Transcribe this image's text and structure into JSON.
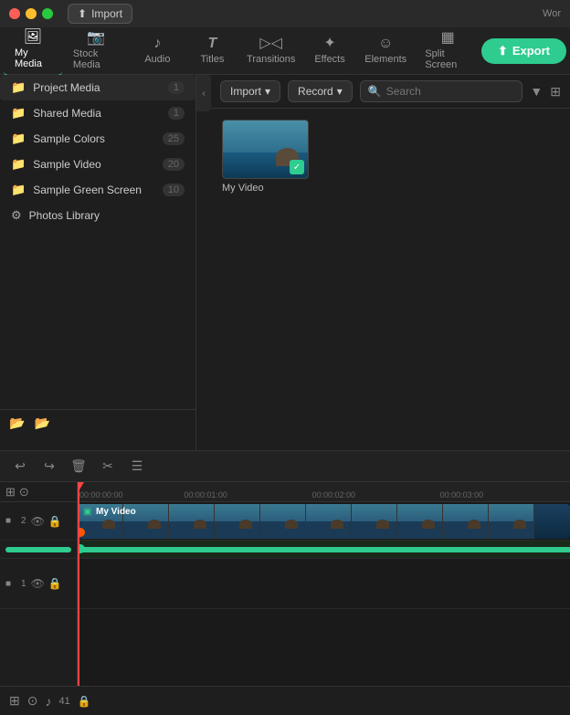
{
  "titlebar": {
    "app_name": "Wor",
    "import_label": "Import",
    "import_icon": "⬆"
  },
  "nav": {
    "tabs": [
      {
        "id": "my-media",
        "label": "My Media",
        "icon": "🖼",
        "active": true
      },
      {
        "id": "stock-media",
        "label": "Stock Media",
        "icon": "📷",
        "active": false
      },
      {
        "id": "audio",
        "label": "Audio",
        "icon": "♪",
        "active": false
      },
      {
        "id": "titles",
        "label": "Titles",
        "icon": "T",
        "active": false
      },
      {
        "id": "transitions",
        "label": "Transitions",
        "icon": "⊳⊲",
        "active": false
      },
      {
        "id": "effects",
        "label": "Effects",
        "icon": "✦",
        "active": false
      },
      {
        "id": "elements",
        "label": "Elements",
        "icon": "☺",
        "active": false
      },
      {
        "id": "split-screen",
        "label": "Split Screen",
        "icon": "▦",
        "active": false
      }
    ],
    "export_label": "Export",
    "export_icon": "⬆"
  },
  "sidebar": {
    "items": [
      {
        "id": "project-media",
        "label": "Project Media",
        "count": "1",
        "active": true
      },
      {
        "id": "shared-media",
        "label": "Shared Media",
        "count": "1",
        "active": false
      },
      {
        "id": "sample-colors",
        "label": "Sample Colors",
        "count": "25",
        "active": false
      },
      {
        "id": "sample-video",
        "label": "Sample Video",
        "count": "20",
        "active": false
      },
      {
        "id": "sample-green-screen",
        "label": "Sample Green Screen",
        "count": "10",
        "active": false
      },
      {
        "id": "photos-library",
        "label": "Photos Library",
        "count": "",
        "active": false
      }
    ]
  },
  "media_panel": {
    "import_label": "Import",
    "record_label": "Record",
    "record_arrow": "▾",
    "import_arrow": "▾",
    "search_placeholder": "Search",
    "items": [
      {
        "id": "my-video",
        "label": "My Video",
        "has_check": true
      }
    ]
  },
  "timeline": {
    "undo_icon": "↩",
    "redo_icon": "↪",
    "delete_icon": "🗑",
    "cut_icon": "✂",
    "list_icon": "☰",
    "time_markers": [
      {
        "time": "00:00:00:00",
        "pos_pct": 0
      },
      {
        "time": "00:00:01:00",
        "pos_pct": 26
      },
      {
        "time": "00:00:02:00",
        "pos_pct": 52
      },
      {
        "time": "00:00:03:00",
        "pos_pct": 78
      }
    ],
    "tracks": [
      {
        "id": "track-2",
        "label": "2",
        "icons": [
          "▣",
          "👁",
          "🔒"
        ],
        "has_clip": true,
        "clip_label": "My Video",
        "clip_icon": "▣"
      },
      {
        "id": "track-green",
        "label": "",
        "is_green": true
      },
      {
        "id": "track-1",
        "label": "1",
        "icons": [
          "▣",
          "👁",
          "🔒"
        ],
        "has_clip": false
      }
    ],
    "bottom": {
      "add_media_icon": "⊞",
      "link_icon": "⊙",
      "volume_icon": "♪",
      "volume_label": "41",
      "lock_icon": "🔒"
    }
  }
}
